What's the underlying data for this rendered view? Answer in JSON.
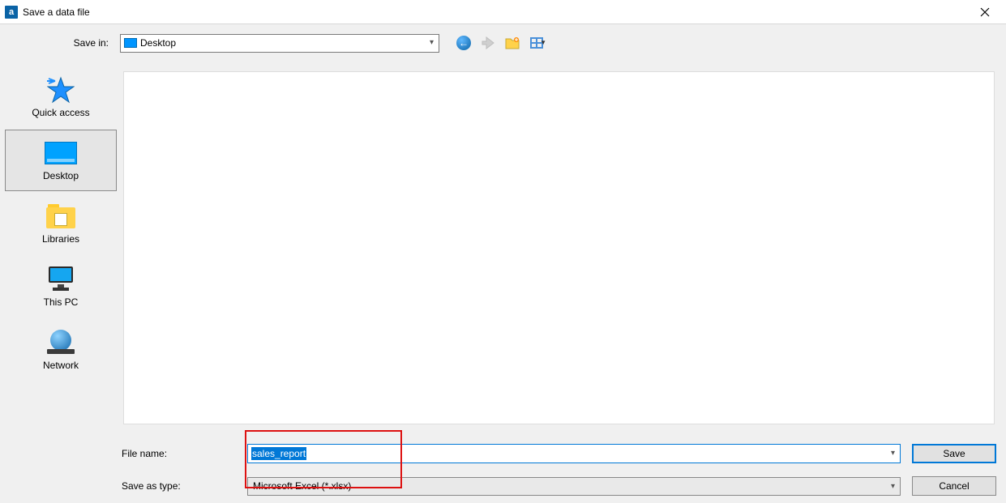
{
  "window": {
    "title": "Save a data file",
    "app_icon_letter": "a"
  },
  "toolbar": {
    "save_in_label": "Save in:",
    "save_in_value": "Desktop"
  },
  "places": {
    "quick_access": "Quick access",
    "desktop": "Desktop",
    "libraries": "Libraries",
    "this_pc": "This PC",
    "network": "Network",
    "selected": "desktop"
  },
  "fields": {
    "file_name_label": "File name:",
    "file_name_value": "sales_report",
    "save_as_type_label": "Save as type:",
    "save_as_type_value": "Microsoft Excel (*.xlsx)"
  },
  "buttons": {
    "save": "Save",
    "cancel": "Cancel"
  }
}
